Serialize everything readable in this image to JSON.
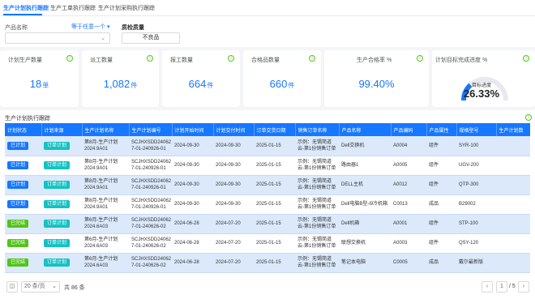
{
  "tabs": [
    {
      "label": "生产计划执行跟踪",
      "active": true
    },
    {
      "label": "生产工单执行跟踪",
      "active": false
    },
    {
      "label": "生产计划采购执行跟踪",
      "active": false
    }
  ],
  "filter": {
    "product_name_label": "产品名称",
    "operator": "等于任意一个",
    "quality_label": "质检质量",
    "quality_value": "不良品"
  },
  "cards": [
    {
      "title": "计划生产数量",
      "value": "18",
      "unit": "单"
    },
    {
      "title": "派工数量",
      "value": "1,082",
      "unit": "件"
    },
    {
      "title": "报工数量",
      "value": "664",
      "unit": "件"
    },
    {
      "title": "合格品数量",
      "value": "660",
      "unit": "件"
    },
    {
      "title": "生产合格率 %",
      "value": "99.40%",
      "unit": ""
    },
    {
      "title": "计划目标完成进度 %",
      "gauge_label": "目标进度",
      "gauge_value": "26.33%",
      "progress": 0.2633
    }
  ],
  "table": {
    "title": "生产计划执行跟踪",
    "columns": [
      "计划状态",
      "计划来源",
      "生产计划名称",
      "生产计划编号",
      "计划开始时间",
      "计划交付时间",
      "订单交货日期",
      "销售订单名称",
      "产品名称",
      "产品编码",
      "产品属性",
      "规格型号",
      "生产计划数"
    ],
    "rows": [
      {
        "status": "已计划",
        "status_type": "plan",
        "source": "订单计划",
        "name": "第8月-生产计划 2024.9A01",
        "code": "SCJHXSDD24062 7-01-240926-01",
        "start": "2024-09-30",
        "end": "2024-09-30",
        "delivery": "2025-01-15",
        "order": "示例：无锡简道 云-第1份销售订单",
        "product": "Dell交换机",
        "pcode": "A0004",
        "attr": "组件",
        "spec": "SYR-100",
        "qty": ""
      },
      {
        "status": "已计划",
        "status_type": "plan",
        "source": "订单计划",
        "name": "第8月-生产计划 2024.9A01",
        "code": "SCJHXSDD24062 7-01-240926-01",
        "start": "2024-09-30",
        "end": "2024-09-30",
        "delivery": "2025-01-15",
        "order": "示例：无锡简道 云-第1份销售订单",
        "product": "路由器1",
        "pcode": "A0005",
        "attr": "组件",
        "spec": "UGV-200",
        "qty": ""
      },
      {
        "status": "已计划",
        "status_type": "plan",
        "source": "订单计划",
        "name": "第8月-生产计划 2024.9A01",
        "code": "SCJHXSDD24062 7-01-240926-01",
        "start": "2024-09-30",
        "end": "2024-09-30",
        "delivery": "2025-01-15",
        "order": "示例：无锡简道 云-第1份销售订单",
        "product": "DELL主机",
        "pcode": "A0012",
        "attr": "组件",
        "spec": "QTP-300",
        "qty": ""
      },
      {
        "status": "已计划",
        "status_type": "plan",
        "source": "订单计划",
        "name": "第8月-生产计划 2024.9A01",
        "code": "SCJHXSDD24062 7-01-240926-01",
        "start": "2024-09-30",
        "end": "2024-09-30",
        "delivery": "2025-01-15",
        "order": "示例：无锡简道 云-第1份销售订单",
        "product": "Dell电脑B型-i9冷机箱",
        "pcode": "C0013",
        "attr": "成品",
        "spec": "B29002",
        "qty": ""
      },
      {
        "status": "已完结",
        "status_type": "done",
        "source": "订单计划",
        "name": "第6月-生产计划 2024.6A03",
        "code": "SCJHXSDD24062 7-01-240626-02",
        "start": "2024-06-28",
        "end": "2024-07-20",
        "delivery": "2025-01-15",
        "order": "示例：无锡简道 云-第1份销售订单",
        "product": "Dell机箱",
        "pcode": "A0001",
        "attr": "组件",
        "spec": "STP-100",
        "qty": ""
      },
      {
        "status": "已完结",
        "status_type": "done",
        "source": "订单计划",
        "name": "第6月-生产计划 2024.6A03",
        "code": "SCJHXSDD24062 7-01-240626-02",
        "start": "2024-06-28",
        "end": "2024-07-20",
        "delivery": "2025-01-15",
        "order": "示例：无锡简道 云-第1份销售订单",
        "product": "联想交换机",
        "pcode": "A0003",
        "attr": "组件",
        "spec": "QSY-120",
        "qty": ""
      },
      {
        "status": "已完结",
        "status_type": "done",
        "source": "订单计划",
        "name": "第6月-生产计划 2024.6A03",
        "code": "SCJHXSDD24062 7-01-240626-02",
        "start": "2024-06-28",
        "end": "2024-07-20",
        "delivery": "2025-01-15",
        "order": "示例：无锡简道 云-第1份销售订单",
        "product": "笔记本电脑",
        "pcode": "C0005",
        "attr": "成品",
        "spec": "戴尔最新版",
        "qty": ""
      }
    ]
  },
  "pagination": {
    "page_size": "20 条/页",
    "total": "共 86 条",
    "current": "1",
    "total_pages": "/ 5"
  },
  "colors": {
    "accent": "#1677ff",
    "done": "#52c41a",
    "order": "#13c2c2",
    "row_alt": "#dbe9fb"
  }
}
